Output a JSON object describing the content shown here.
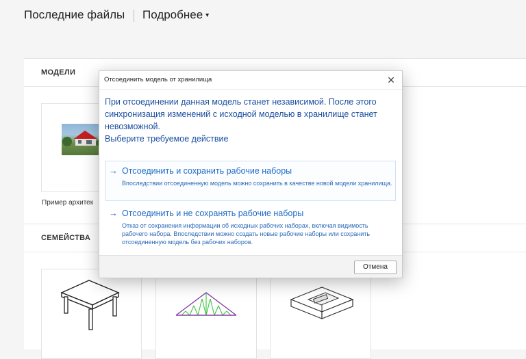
{
  "header": {
    "title": "Последние файлы",
    "view_label": "Подробнее",
    "view_caret": "▾"
  },
  "sections": {
    "models_label": "МОДЕЛИ",
    "families_label": "СЕМЕЙСТВА"
  },
  "models": [
    {
      "caption": "Пример архитек"
    }
  ],
  "dialog": {
    "title": "Отсоединить модель от хранилища",
    "close_glyph": "✕",
    "message_lines": [
      "При отсоединении данная модель станет независимой. После этого",
      "синхронизация изменений с исходной моделью в хранилище станет",
      "невозможной.",
      "Выберите требуемое действие"
    ],
    "actions": [
      {
        "arrow": "→",
        "heading": "Отсоединить и сохранить рабочие наборы",
        "description": "Впоследствии отсоединенную модель можно сохранить в качестве новой модели хранилища."
      },
      {
        "arrow": "→",
        "heading": "Отсоединить и не сохранять рабочие наборы",
        "description": "Отказ от сохранения информации об исходных рабочих наборах, включая видимость рабочего набора. Впоследствии можно создать новые рабочие наборы или сохранить отсоединенную модель без рабочих наборов."
      }
    ],
    "cancel_label": "Отмена"
  },
  "colors": {
    "dialog_accent": "#1f6cc7",
    "message_text": "#1b4fa0",
    "truss_green": "#3cc33c",
    "truss_purple": "#8a3ca8"
  }
}
